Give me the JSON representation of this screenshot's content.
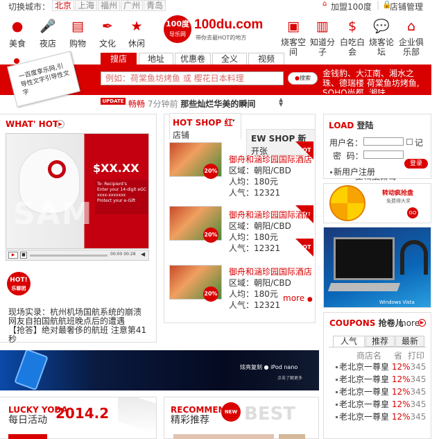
{
  "topbar": {
    "switch_label": "切换城市：",
    "cities": [
      "北京",
      "上海",
      "福州",
      "广州",
      "青岛"
    ],
    "join": "加盟100度",
    "store_mgmt": "店铺管理"
  },
  "logo": {
    "badge": "100度",
    "sub": "导乐网",
    "name": "100du.com",
    "slogan": "带你去最HOT的地方"
  },
  "nav_left": [
    {
      "label": "美食",
      "icon": "tomato-icon"
    },
    {
      "label": "夜店",
      "icon": "microphone-icon"
    },
    {
      "label": "购物",
      "icon": "shopping-bag-icon"
    },
    {
      "label": "文化",
      "icon": "pen-icon"
    },
    {
      "label": "休闲",
      "icon": "star-icon"
    }
  ],
  "nav_right": [
    {
      "label": "烧客空间",
      "icon": "suitcase-icon"
    },
    {
      "label": "知道分子",
      "icon": "notebook-icon"
    },
    {
      "label": "白吃白会",
      "icon": "coin-icon"
    },
    {
      "label": "烧客论坛",
      "icon": "chat-icon"
    },
    {
      "label": "企业俱乐部",
      "icon": "building-icon"
    }
  ],
  "search": {
    "tabs": [
      "搜店",
      "地址",
      "优惠卷",
      "全义",
      "视频"
    ],
    "placeholder": "例如：荷棠鱼坊烤鱼 或 樱花日本料理",
    "button": "搜索",
    "note": "一百度享乐网,引导性文字引导性文字",
    "hot_words": "金钱豹、大江南、湘水之珠、德瑞楼 荷棠鱼坊烤鱼, SOHO尚都, 湘味"
  },
  "update": {
    "tag": "UPDATE",
    "user": "畅畅",
    "time": "7分钟前",
    "text": "那些灿烂华美的瞬间"
  },
  "whathot": {
    "title": "WHAT' HOT",
    "price": "$XX.XX",
    "card_line1": "To: Recipient's",
    "card_line2": "Enter your 14-digit eGC",
    "card_line3": "xxxx-xxxxxxx",
    "card_line4": "Protect your e-Gift",
    "watermark": "SAM",
    "time": "00:00",
    "time_total": "00:28",
    "hotbadge": "HOT!",
    "hotbadge_sub": "乐聊团",
    "news": [
      "现场实录：杭州机场国航系统的崩溃",
      "网友自拍国航航班晚点后的遭遇",
      "【抢答】绝对最奢侈的航班 注意第41秒"
    ]
  },
  "hotshop": {
    "tab1": "HOT SHOP 红",
    "tab1b": "店铺",
    "tab2": "EW SHOP 新",
    "tab2b": "开张",
    "items": [
      {
        "name": "御舟和涵珍园国际酒店",
        "area": "区域：朝阳/CBD",
        "avg": "人均：180元",
        "pop": "人气：12321",
        "discount": "20%",
        "tag": "HOT"
      },
      {
        "name": "御舟和涵珍园国际酒店",
        "area": "区域：朝阳/CBD",
        "avg": "人均：180元",
        "pop": "人气：12321",
        "discount": "20%",
        "tag": "HOT"
      },
      {
        "name": "御舟和涵珍园国际酒店",
        "area": "区域：朝阳/CBD",
        "avg": "人均：180元",
        "pop": "人气：12321",
        "discount": "20%",
        "tag": "HOT"
      }
    ],
    "more": "more"
  },
  "login": {
    "title": "LOAD",
    "title_cn": "登陆",
    "user_label": "用户名：",
    "pwd_label": "密  码：",
    "remember": "记",
    "button": "登录",
    "register": "新用户注册",
    "forgot": "忘记密码了"
  },
  "lottery": {
    "title": "转动疯抢盘",
    "sub": "免费得大奖",
    "go": "GO"
  },
  "laptop": {
    "brand": "Windows Vista"
  },
  "coupons": {
    "title": "COUPONS",
    "title_cn": "抢卷儿",
    "more": "more",
    "tabs": [
      "人气",
      "推荐",
      "最新"
    ],
    "headers": [
      "商店名",
      "省",
      "打印"
    ],
    "rows": [
      {
        "name": "老北京一尊皇",
        "pct": "12%",
        "num": "345"
      },
      {
        "name": "老北京一尊皇",
        "pct": "12%",
        "num": "345"
      },
      {
        "name": "老北京一尊皇",
        "pct": "12%",
        "num": "345"
      },
      {
        "name": "老北京一尊皇",
        "pct": "12%",
        "num": "345"
      },
      {
        "name": "老北京一尊皇",
        "pct": "12%",
        "num": "345"
      }
    ]
  },
  "banner": {
    "text": "炫亮复刻",
    "product": "iPod nano",
    "sub": "点击了解更多"
  },
  "lucky": {
    "title": "LUCKY YODA",
    "date": "2014.2",
    "sub": "每日活动"
  },
  "recommend": {
    "title": "RECOMMEND",
    "badge": "NEW",
    "best": "BEST",
    "sub": "精彩推荐"
  },
  "colors": {
    "brand": "#d90000",
    "bg": "#ffffff"
  }
}
